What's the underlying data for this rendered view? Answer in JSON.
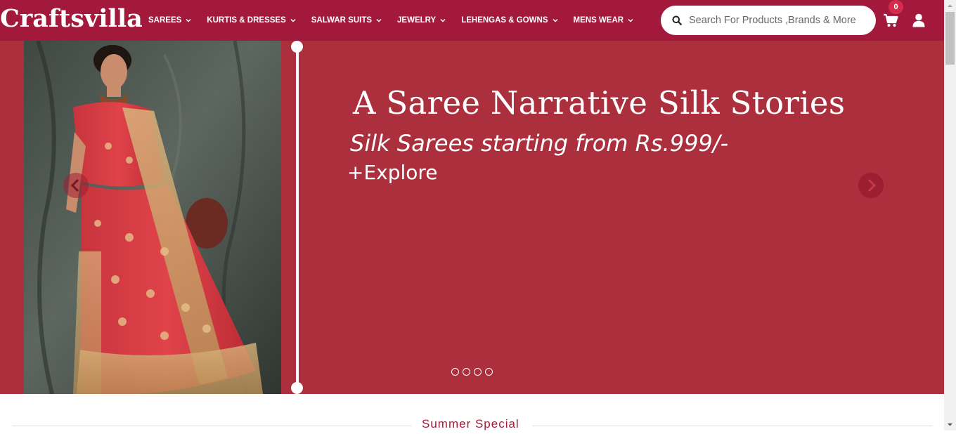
{
  "brand": {
    "logo_text": "Craftsvilla"
  },
  "nav": {
    "items": [
      {
        "label": "SAREES"
      },
      {
        "label": "KURTIS & DRESSES"
      },
      {
        "label": "SALWAR SUITS"
      },
      {
        "label": "JEWELRY"
      },
      {
        "label": "LEHENGAS & GOWNS"
      },
      {
        "label": "MENS WEAR"
      }
    ]
  },
  "search": {
    "placeholder": "Search For Products ,Brands & More",
    "value": "",
    "icon": "search-icon"
  },
  "cart": {
    "count": "0",
    "icon": "shopping-cart-icon"
  },
  "account": {
    "icon": "user-icon"
  },
  "hero": {
    "title": "A Saree Narrative Silk Stories",
    "subtitle": "Silk Sarees starting from Rs.999/-",
    "cta": "+Explore",
    "slide_count": 4,
    "background_color": "#ab2f3c"
  },
  "section": {
    "title": "Summer Special"
  },
  "colors": {
    "header": "#a2193b",
    "badge": "#d42b4f",
    "accent_text": "#a2193b"
  }
}
